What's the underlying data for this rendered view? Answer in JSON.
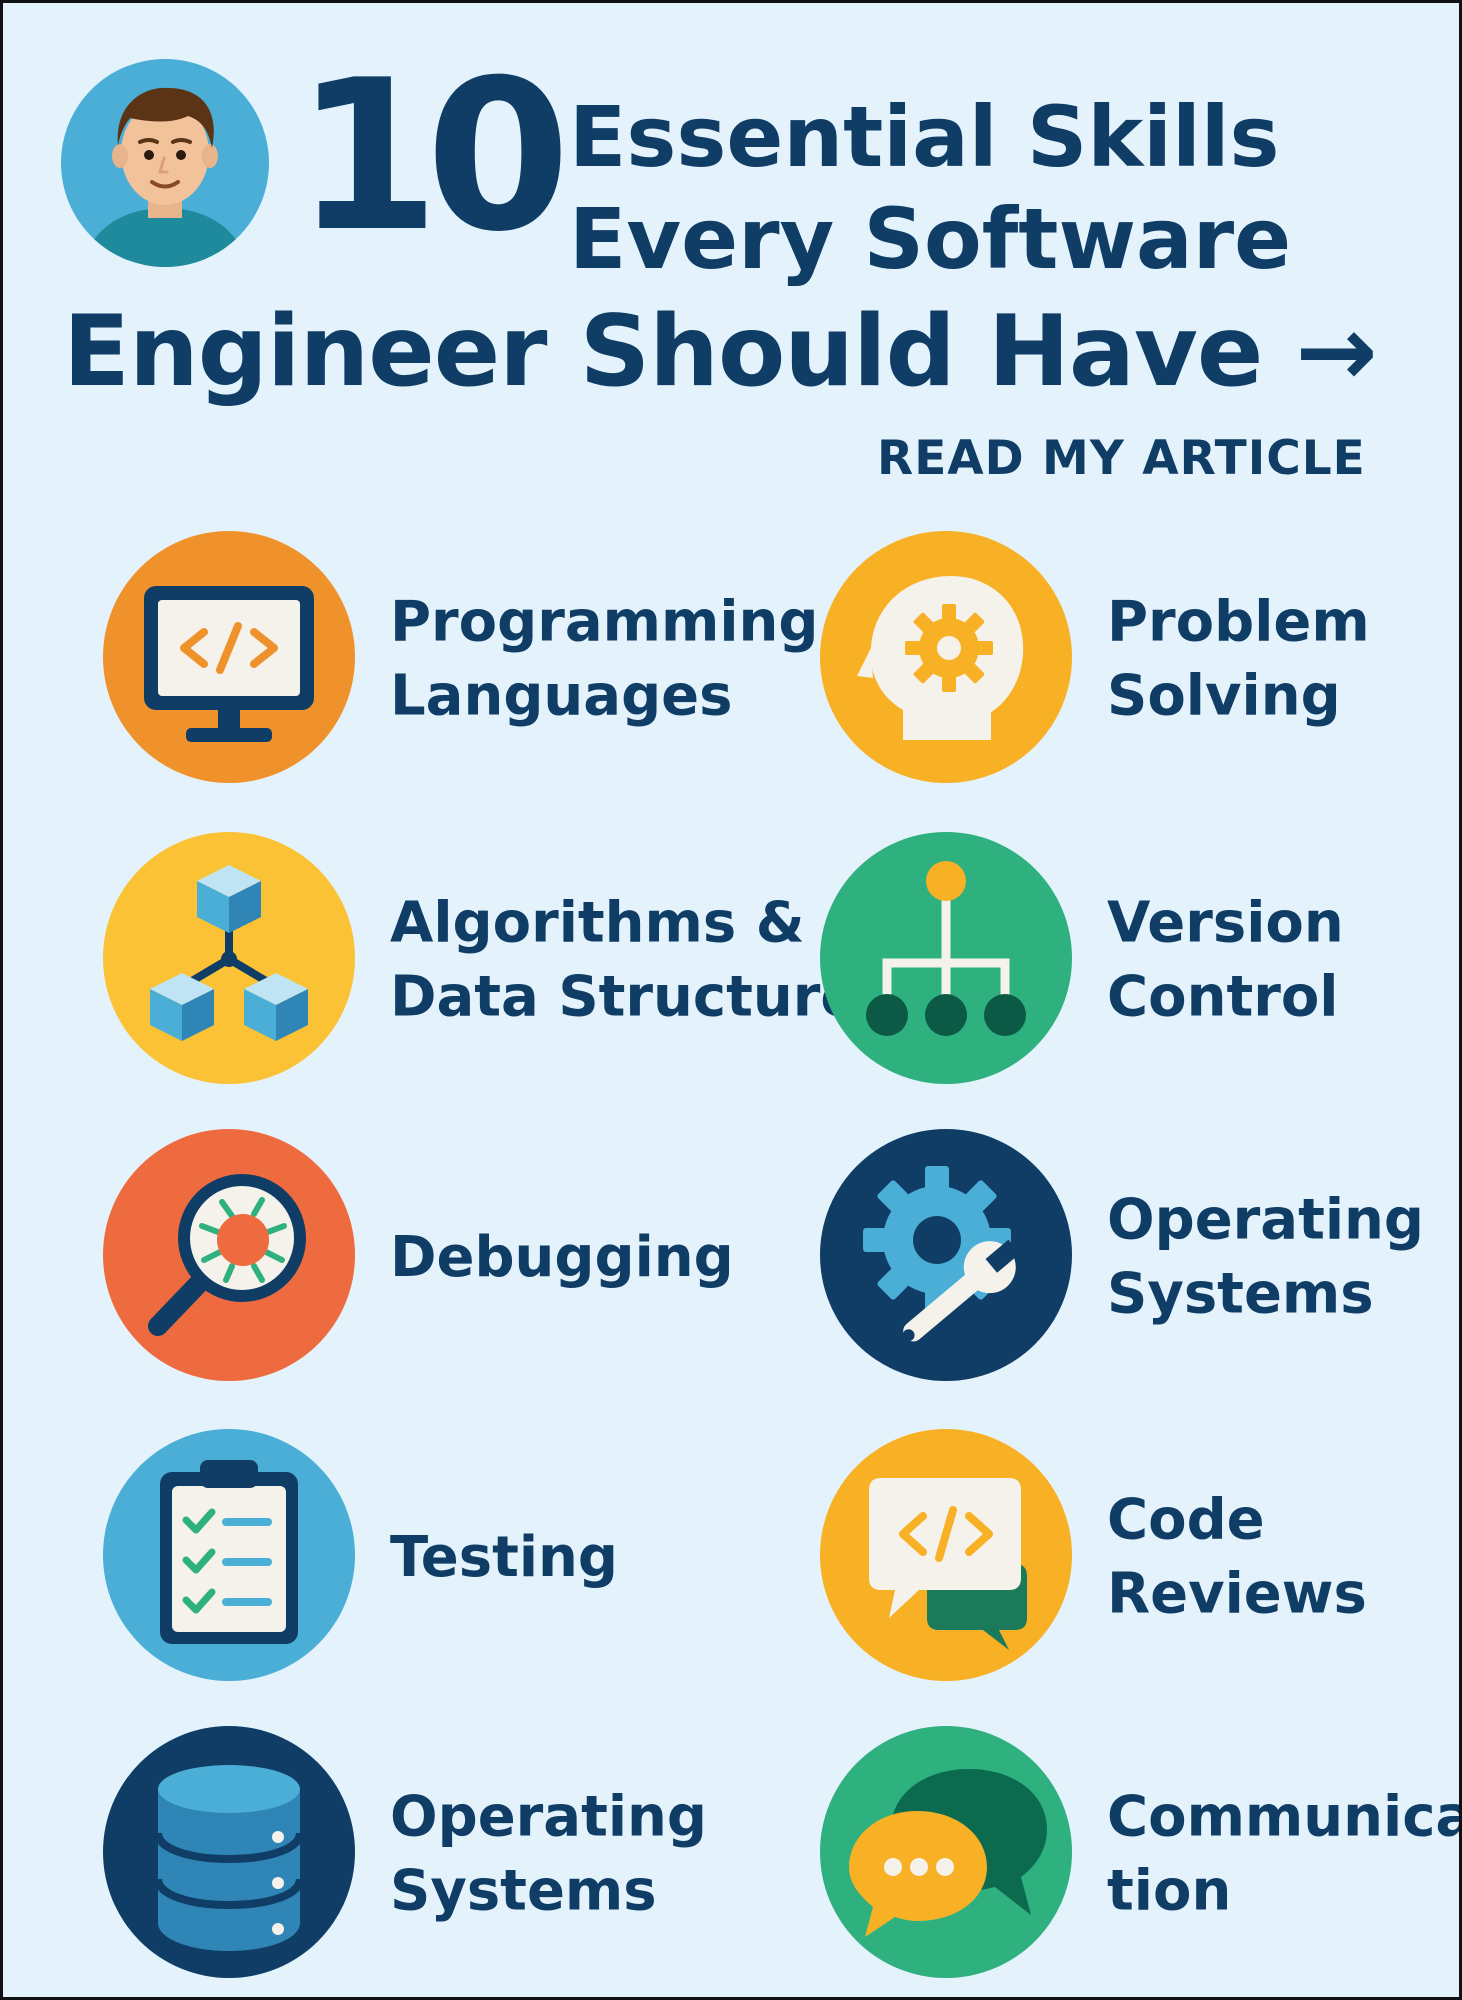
{
  "header": {
    "number": "10",
    "line1": "Essential Skills",
    "line2": "Every Software",
    "line3": "Engineer Should Have →",
    "cta": "READ MY ARTICLE"
  },
  "skills": [
    {
      "line1": "Programming",
      "line2": "Languages",
      "icon": "code-monitor-icon",
      "color": "#f0922b"
    },
    {
      "line1": "Problem",
      "line2": "Solving",
      "icon": "head-gear-icon",
      "color": "#f8b025"
    },
    {
      "line1": "Algorithms &",
      "line2": "Data Structures",
      "icon": "cubes-icon",
      "color": "#fbc235"
    },
    {
      "line1": "Version",
      "line2": "Control",
      "icon": "branch-tree-icon",
      "color": "#2eb07f"
    },
    {
      "line1": "Debugging",
      "line2": "",
      "icon": "magnifier-bug-icon",
      "color": "#ee6b3f"
    },
    {
      "line1": "Operating",
      "line2": "Systems",
      "icon": "gear-wrench-icon",
      "color": "#0f3d66"
    },
    {
      "line1": "Testing",
      "line2": "",
      "icon": "clipboard-checklist-icon",
      "color": "#4aaed6"
    },
    {
      "line1": "Code",
      "line2": "Reviews",
      "icon": "code-speech-bubble-icon",
      "color": "#f8b025"
    },
    {
      "line1": "Operating",
      "line2": "Systems",
      "icon": "database-icon",
      "color": "#0f3d66"
    },
    {
      "line1": "Communica-",
      "line2": "tion",
      "icon": "chat-bubbles-icon",
      "color": "#2eb07f"
    }
  ]
}
